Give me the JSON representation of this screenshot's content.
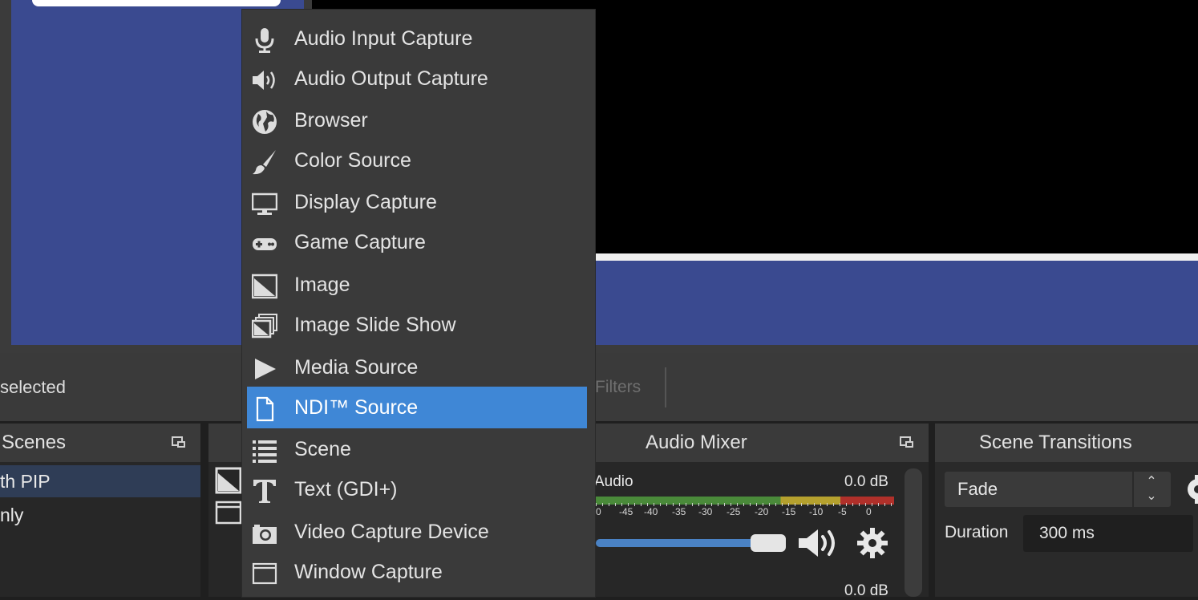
{
  "preview": {
    "no_source_text": "selected",
    "filters_label": "Filters"
  },
  "context_menu": {
    "items": [
      {
        "label": "Audio Input Capture",
        "icon": "microphone-icon"
      },
      {
        "label": "Audio Output Capture",
        "icon": "speaker-icon"
      },
      {
        "label": "Browser",
        "icon": "globe-icon"
      },
      {
        "label": "Color Source",
        "icon": "paintbrush-icon"
      },
      {
        "label": "Display Capture",
        "icon": "monitor-icon"
      },
      {
        "label": "Game Capture",
        "icon": "gamepad-icon"
      },
      {
        "label": "Image",
        "icon": "image-icon"
      },
      {
        "label": "Image Slide Show",
        "icon": "slideshow-icon"
      },
      {
        "label": "Media Source",
        "icon": "play-icon"
      },
      {
        "label": "NDI™ Source",
        "icon": "file-icon",
        "highlighted": true
      },
      {
        "label": "Scene",
        "icon": "list-icon"
      },
      {
        "label": "Text (GDI+)",
        "icon": "text-icon"
      },
      {
        "label": "Video Capture Device",
        "icon": "camera-icon"
      },
      {
        "label": "Window Capture",
        "icon": "window-icon"
      }
    ]
  },
  "scenes": {
    "title": "Scenes",
    "items": [
      "th PIP",
      "nly"
    ]
  },
  "audio_mixer": {
    "title": "Audio Mixer",
    "channel_name": "Audio",
    "db_value": "0.0 dB",
    "db_value_2": "0.0 dB",
    "ticks": [
      "0",
      "-45",
      "-40",
      "-35",
      "-30",
      "-25",
      "-20",
      "-15",
      "-10",
      "-5",
      "0"
    ]
  },
  "scene_transitions": {
    "title": "Scene Transitions",
    "transition": "Fade",
    "duration_label": "Duration",
    "duration_value": "300 ms"
  },
  "colors": {
    "highlight": "#3f87d6",
    "canvas_blue": "#3a4a90"
  }
}
